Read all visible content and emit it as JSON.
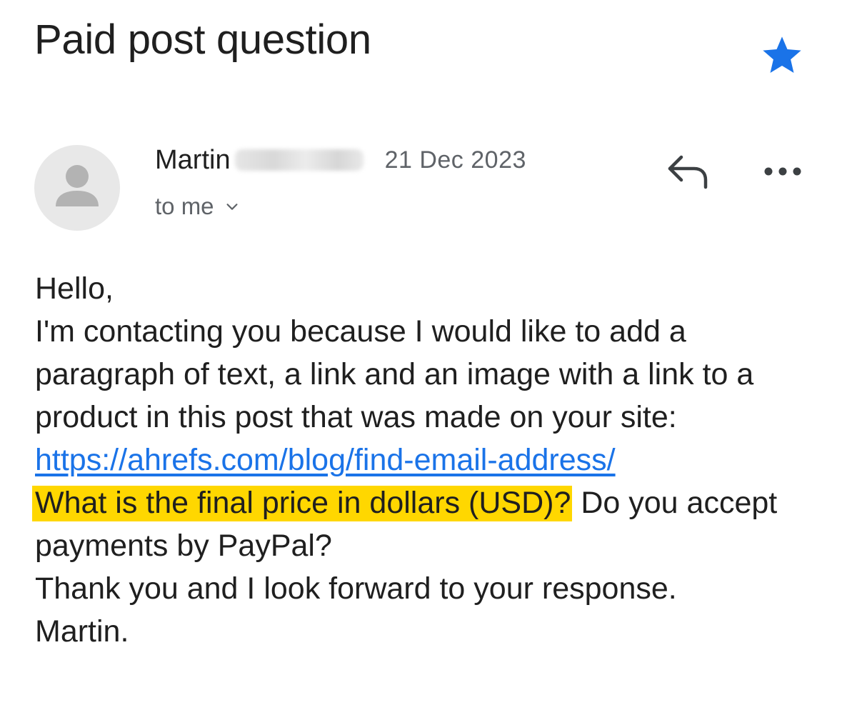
{
  "email": {
    "subject": "Paid post question",
    "starred": true,
    "star_color": "#1a73e8",
    "star_icon": "star-icon",
    "sender": {
      "name": "Martin",
      "avatar_icon": "person-icon"
    },
    "date": "21 Dec 2023",
    "recipient": "to me",
    "recipient_toggle_icon": "chevron-down-icon",
    "reply_icon": "reply-icon",
    "more_icon": "more-horizontal-icon",
    "body": {
      "greeting": "Hello,",
      "intro": "I'm contacting you because I would like to add a paragraph of text, a link and an image with a link to a product in this post that was made on your site:",
      "link": "https://ahrefs.com/blog/find-email-address/",
      "question_highlighted": "What is the final price in dollars (USD)?",
      "question_rest": " Do you accept payments by PayPal?",
      "thanks": "Thank you and I look forward to your response.",
      "signature": "Martin."
    },
    "highlight_color": "#ffd700",
    "link_color": "#1a73e8"
  }
}
